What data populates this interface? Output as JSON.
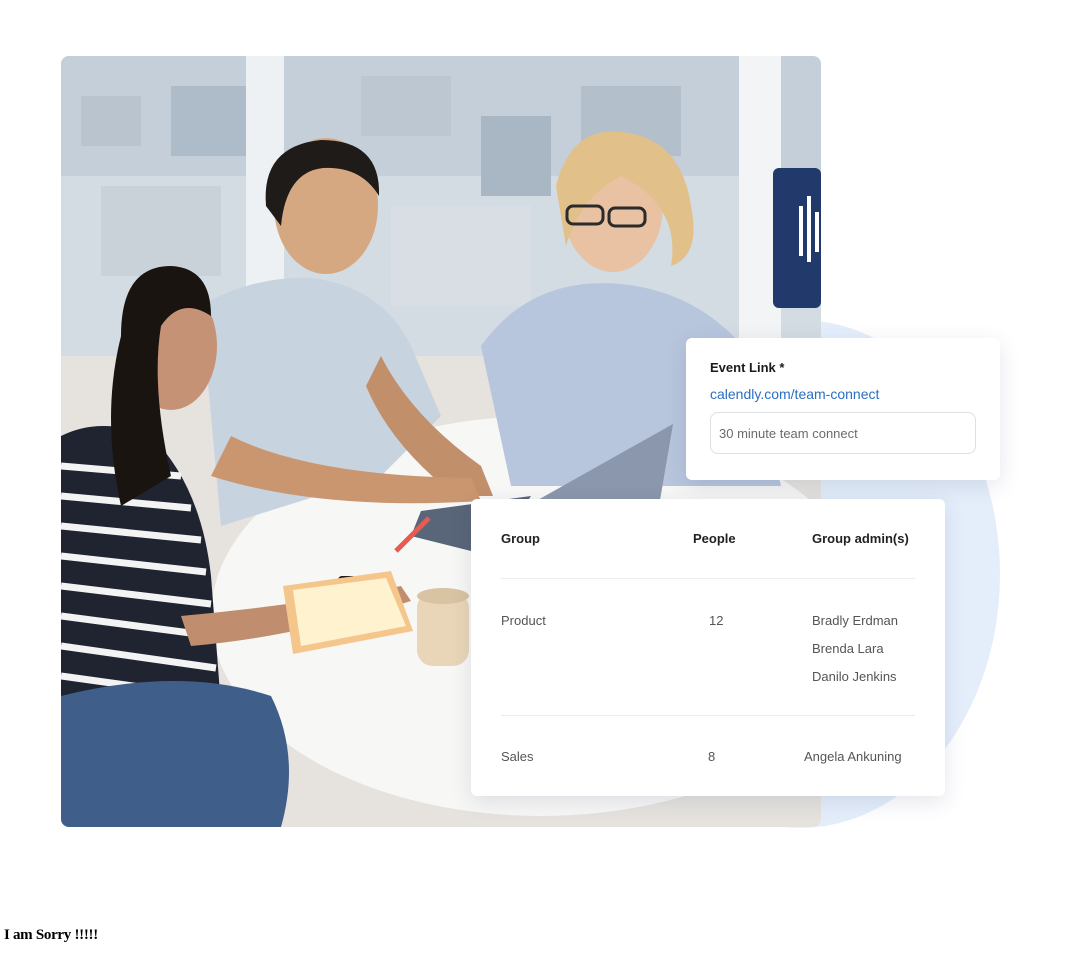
{
  "event_card": {
    "label": "Event Link *",
    "link": "calendly.com/team-connect",
    "input_value": "30 minute team connect"
  },
  "group_table": {
    "headers": {
      "group": "Group",
      "people": "People",
      "admins": "Group admin(s)"
    },
    "rows": [
      {
        "group": "Product",
        "people": "12",
        "admins": [
          "Bradly Erdman",
          "Brenda Lara",
          "Danilo Jenkins"
        ]
      },
      {
        "group": "Sales",
        "people": "8",
        "admins": [
          "Angela Ankuning"
        ]
      }
    ]
  },
  "footer": {
    "message": "I am Sorry !!!!!"
  },
  "colors": {
    "link": "#2a6fc4",
    "accent_circle": "#e4eefb",
    "card_bg": "#ffffff"
  }
}
